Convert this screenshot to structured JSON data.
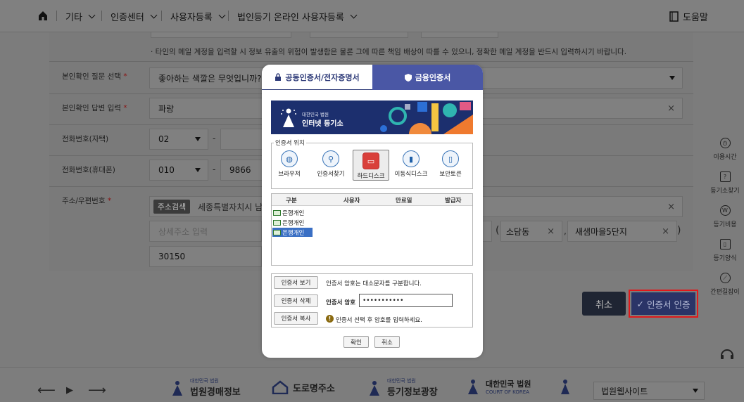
{
  "nav": {
    "items": [
      "기타",
      "인증센터",
      "사용자등록",
      "법인등기 온라인 사용자등록"
    ],
    "help_label": "도움말"
  },
  "form": {
    "notice": "· 타인의 메일 계정을 입력할 시 정보 유출의 위험이 발생함은 물론 그에 따른 책임 배상이 따를 수 있으니, 정확한 메일 계정을 반드시 입력하시기 바랍니다.",
    "question_label": "본인확인 질문 선택",
    "question_value": "좋아하는 색깔은 무엇입니까?(예:파",
    "answer_label": "본인확인 답변 입력",
    "answer_value": "파랑",
    "phone_home_label": "전화번호(자택)",
    "phone_home_prefix": "02",
    "phone_mobile_label": "전화번호(휴대폰)",
    "phone_mobile_prefix": "010",
    "phone_mobile_mid": "9866",
    "address_label": "주소/우편번호",
    "address_search_button": "주소검색",
    "address_value": "세종특별자치시 남세",
    "detail_placeholder": "상세주소 입력",
    "dong_value": "소담동",
    "building_value": "새샘마을5단지",
    "postal_code": "30150",
    "required_mark": "*",
    "dash": "-",
    "clear_mark": "×"
  },
  "actions": {
    "cancel_label": "취소",
    "cert_label": "인증서 인증",
    "check_mark": "✓"
  },
  "right_sidebar": {
    "items": [
      "이용시간",
      "등기소찾기",
      "등기비용",
      "등기양식",
      "간편길잡이"
    ]
  },
  "footer": {
    "logos": [
      {
        "small": "대한민국 법원",
        "big": "법원경매정보"
      },
      {
        "small": "",
        "big": "도로명주소"
      },
      {
        "small": "대한민국 법원",
        "big": "등기정보광장"
      },
      {
        "small": "COURT OF KOREA",
        "big": "대한민국 법원"
      }
    ],
    "site_select": "법원웹사이트",
    "nav_prev": "⟵",
    "nav_play": "▶",
    "nav_next": "⟶"
  },
  "modal": {
    "tabs": [
      {
        "label": "공동인증서/전자증명서",
        "active": true
      },
      {
        "label": "금융인증서",
        "active": false
      }
    ],
    "banner": {
      "small": "대한민국 법원",
      "title": "인터넷 등기소"
    },
    "location_legend": "인증서 위치",
    "locations": [
      "브라우저",
      "인증서찾기",
      "하드디스크",
      "이동식디스크",
      "보안토큰"
    ],
    "selected_location": "하드디스크",
    "table_headers": [
      "구분",
      "사용자",
      "만료일",
      "발급자"
    ],
    "certs": [
      "은행개인",
      "은행개인",
      "은행개인"
    ],
    "buttons": {
      "view": "인증서 보기",
      "delete": "인증서 삭제",
      "copy": "인증서 복사",
      "ok": "확인",
      "cancel": "취소"
    },
    "case_notice": "인증서 암호는 대소문자를 구분합니다.",
    "password_label": "인증서 암호",
    "password_value": "•••••••••••",
    "select_notice": "인증서 선택 후 암호를 입력하세요."
  },
  "colors": {
    "accent": "#2d3a78",
    "tab_inactive": "#4a57a5",
    "highlight_border": "#e0191b"
  }
}
